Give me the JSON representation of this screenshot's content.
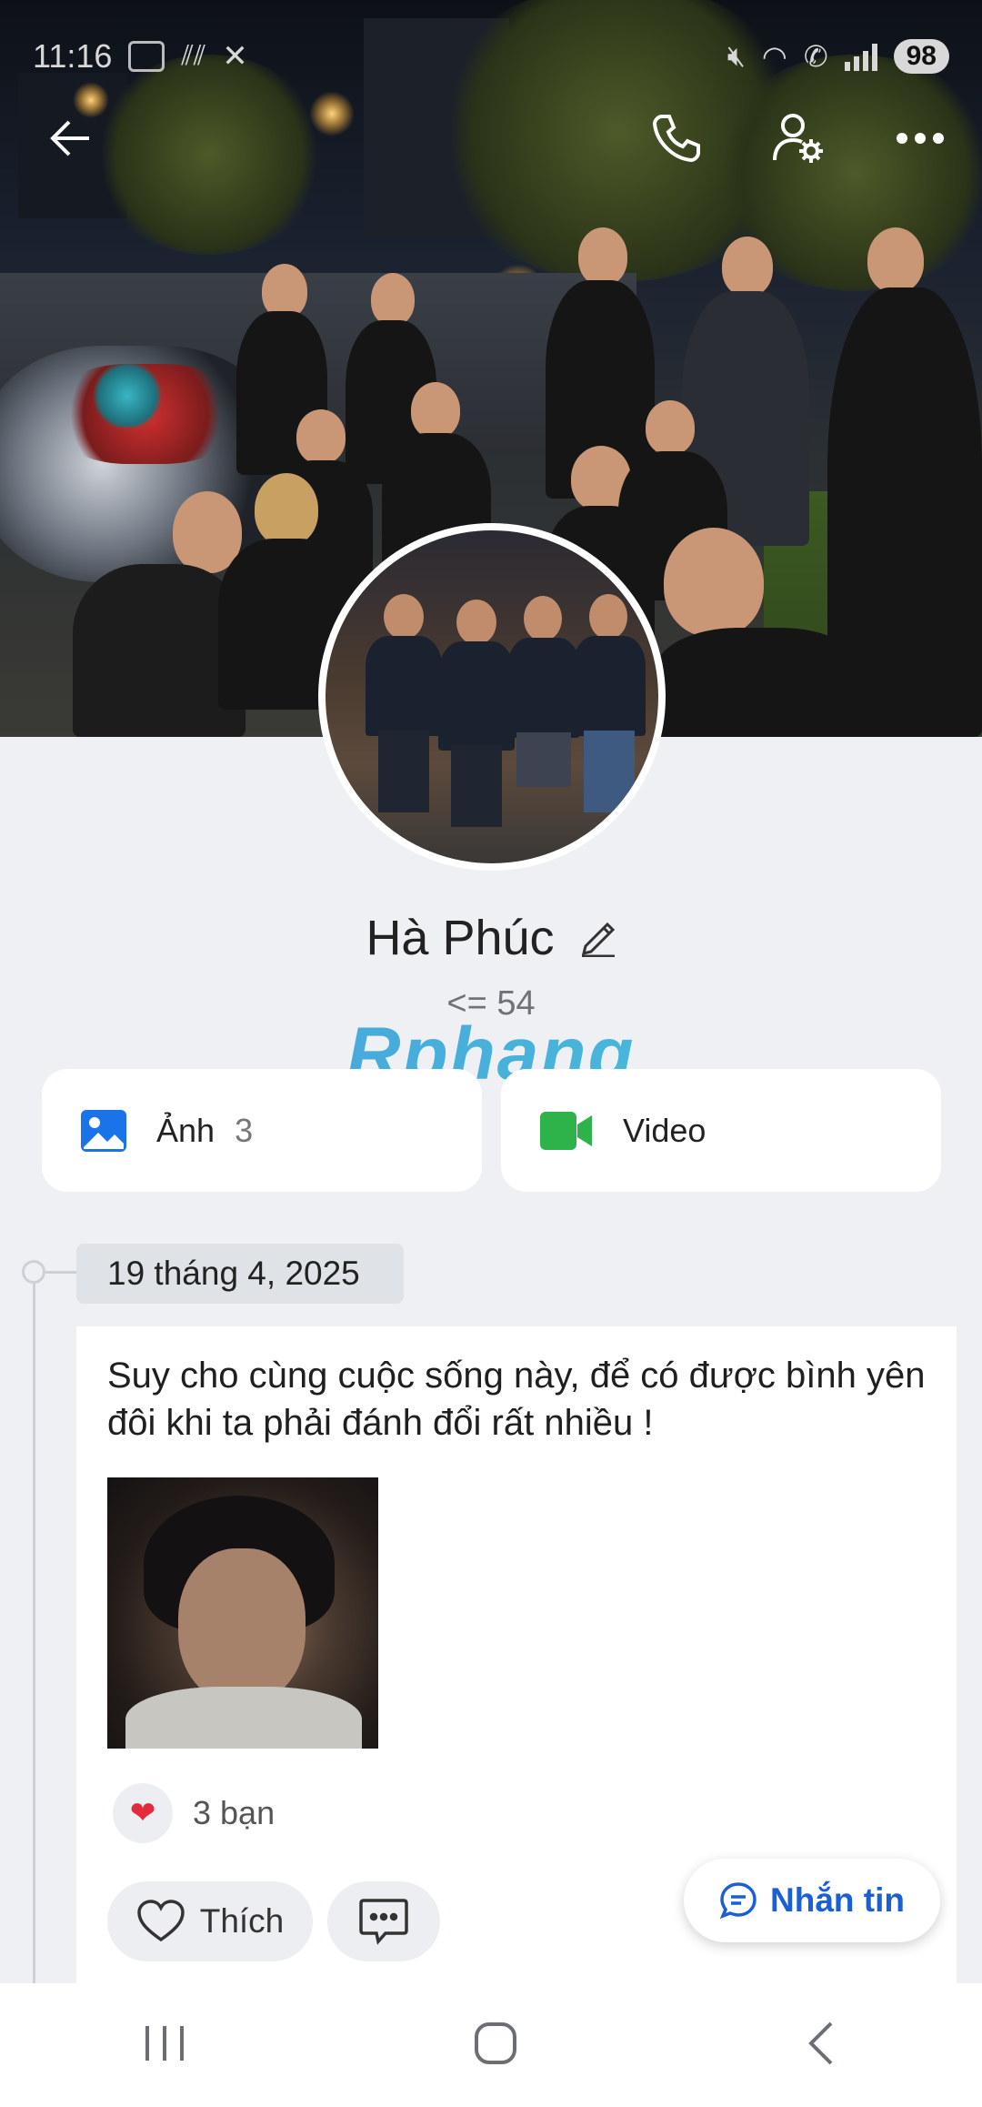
{
  "status_bar": {
    "time": "11:16",
    "battery": "98"
  },
  "profile": {
    "name": "Hà Phúc",
    "subline": "<= 54",
    "watermark": "Rphang"
  },
  "media": {
    "photos_label": "Ảnh",
    "photos_count": "3",
    "video_label": "Video"
  },
  "timeline": {
    "date": "19 tháng 4, 2025",
    "post": {
      "text": "Suy cho cùng cuộc sống này, để có được bình yên đôi khi ta phải đánh đổi rất nhiều !",
      "reaction_count": "3 bạn",
      "like_label": "Thích"
    }
  },
  "fab": {
    "label": "Nhắn tin"
  },
  "colors": {
    "accent": "#1a5fd6",
    "photo_icon": "#1a73e8",
    "video_icon": "#2db34a",
    "heart": "#e32b3c",
    "background": "#eef0f4"
  },
  "icons": [
    "back-arrow-icon",
    "phone-icon",
    "user-settings-icon",
    "more-icon",
    "edit-pencil-icon",
    "photo-icon",
    "video-camera-icon",
    "heart-icon",
    "comment-icon",
    "chat-bubble-icon"
  ]
}
